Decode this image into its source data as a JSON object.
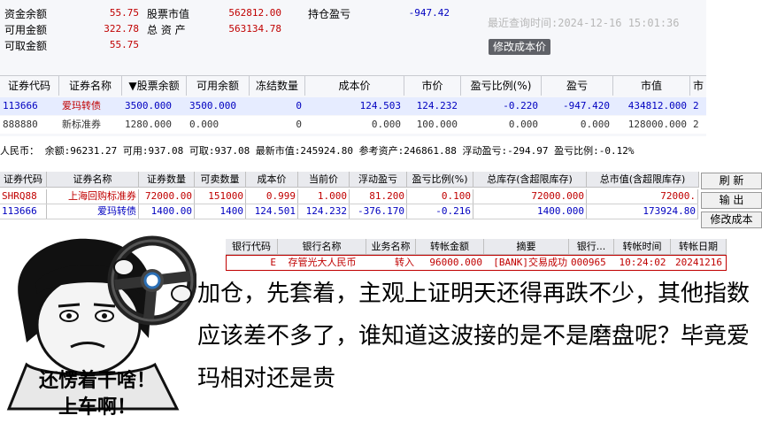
{
  "account": {
    "fund_balance_label": "资金余额",
    "fund_balance": "55.75",
    "available_label": "可用金额",
    "available": "322.78",
    "withdrawable_label": "可取金额",
    "withdrawable": "55.75",
    "stock_value_label": "股票市值",
    "stock_value": "562812.00",
    "total_assets_label": "总 资 产",
    "total_assets": "563134.78",
    "position_pnl_label": "持仓盈亏",
    "position_pnl": "-947.42",
    "query_time": "最近查询时间:2024-12-16 15:01:36",
    "modify_cost_button": "修改成本价"
  },
  "holdings_table": {
    "columns": [
      "证券代码",
      "证券名称",
      "▼股票余额",
      "可用余额",
      "冻结数量",
      "成本价",
      "市价",
      "盈亏比例(%)",
      "盈亏",
      "市值",
      "市"
    ],
    "rows": [
      [
        "113666",
        "爱玛转债",
        "3500.000",
        "3500.000",
        "0",
        "124.503",
        "124.232",
        "-0.220",
        "-947.420",
        "434812.000",
        "2"
      ],
      [
        "888880",
        "新标准券",
        "1280.000",
        "0.000",
        "0",
        "0.000",
        "100.000",
        "0.000",
        "0.000",
        "128000.000",
        "2"
      ]
    ]
  },
  "summary_strip": "人民币： 余额:96231.27  可用:937.08  可取:937.08  最新市值:245924.80  参考资产:246861.88  浮动盈亏:-294.97  盈亏比例:-0.12%",
  "positions_table": {
    "columns": [
      "证券代码",
      "证券名称",
      "证券数量",
      "可卖数量",
      "成本价",
      "当前价",
      "浮动盈亏",
      "盈亏比例(%)",
      "总库存(含超限库存)",
      "总市值(含超限库存)"
    ],
    "rows": [
      [
        "SHRQ88",
        "上海回购标准券",
        "72000.00",
        "151000",
        "0.999",
        "1.000",
        "81.200",
        "0.100",
        "72000.000",
        "72000."
      ],
      [
        "113666",
        "爱玛转债",
        "1400.00",
        "1400",
        "124.501",
        "124.232",
        "-376.170",
        "-0.216",
        "1400.000",
        "173924.80"
      ]
    ],
    "buttons": [
      "刷 新",
      "输 出",
      "修改成本"
    ]
  },
  "transfer_table": {
    "columns": [
      "银行代码",
      "银行名称",
      "业务名称",
      "转帐金额",
      "摘要",
      "银行...",
      "转帐时间",
      "转帐日期"
    ],
    "row": [
      "E",
      "存管光大人民币",
      "转入",
      "96000.000",
      "[BANK]交易成功",
      "000965",
      "10:24:02",
      "20241216"
    ]
  },
  "meme": {
    "line1": "还愣着干啥！",
    "line2": "上车啊！"
  },
  "caption": "加仓，先套着，主观上证明天还得再跌不少，其他指数应该差不多了，谁知道这波接的是不是磨盘呢？毕竟爱玛相对还是贵",
  "colors": {
    "red": "#c00000",
    "blue": "#0000c0",
    "selected_row": "#e6ecff"
  }
}
